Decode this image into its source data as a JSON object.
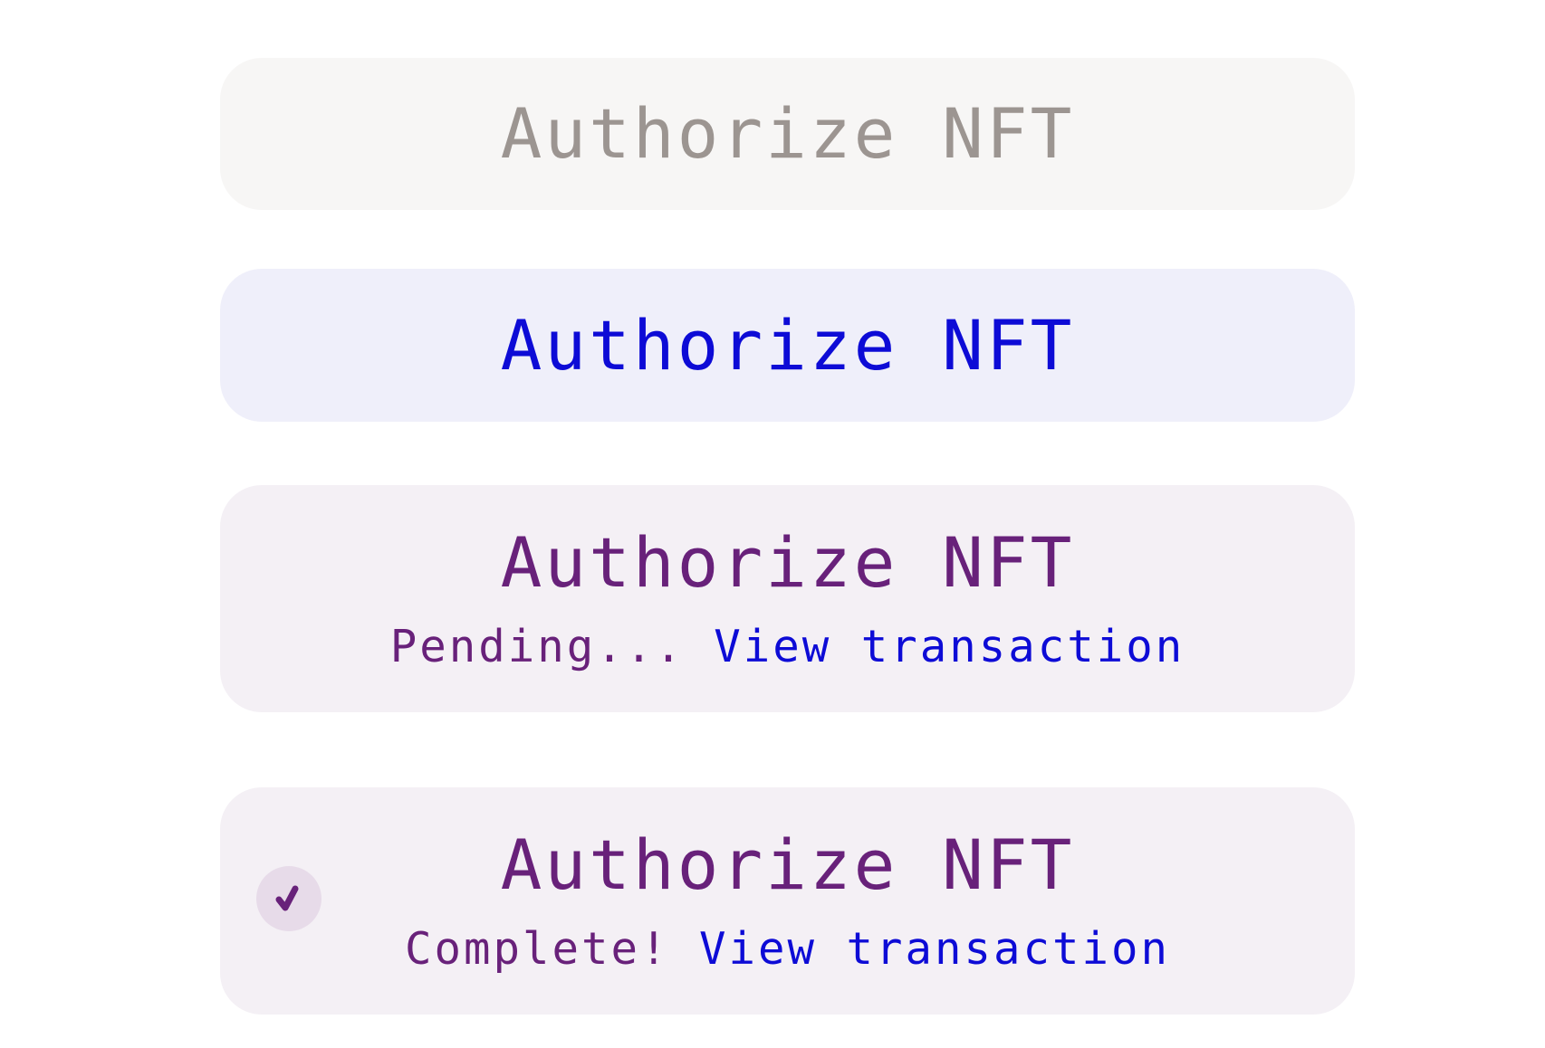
{
  "buttons": [
    {
      "label": "Authorize NFT",
      "state": "disabled"
    },
    {
      "label": "Authorize NFT",
      "state": "enabled"
    },
    {
      "label": "Authorize NFT",
      "state": "pending",
      "status_text": "Pending...",
      "link_text": "View transaction"
    },
    {
      "label": "Authorize NFT",
      "state": "complete",
      "status_text": "Complete!",
      "link_text": "View transaction",
      "icon": "check-icon"
    }
  ],
  "colors": {
    "disabled_bg": "#f7f6f5",
    "disabled_text": "#9c9591",
    "enabled_bg": "#efeffa",
    "accent_blue": "#0d0bd6",
    "purple": "#68217a",
    "purple_bg": "#f4f0f5",
    "check_badge_bg": "#e7dbe9"
  }
}
